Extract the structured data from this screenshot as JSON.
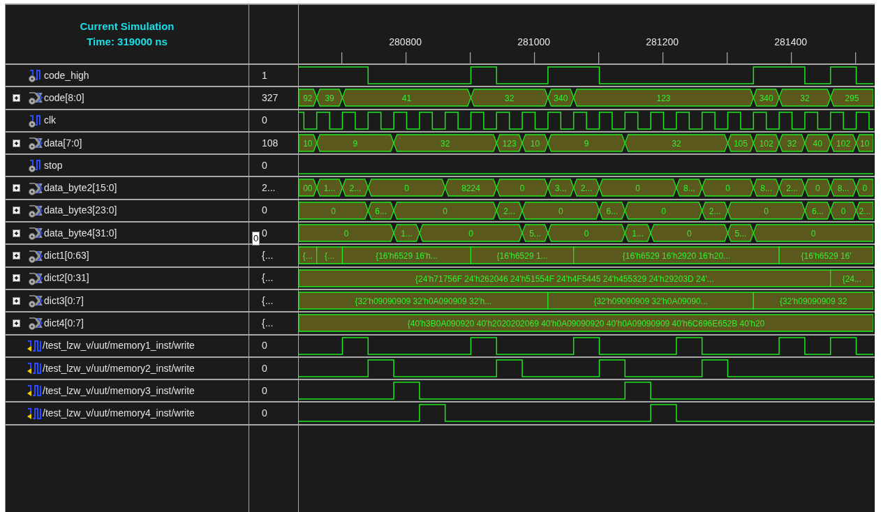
{
  "header": {
    "title": "Current Simulation",
    "time": "Time: 319000 ns"
  },
  "ruler": {
    "labels": [
      "280800",
      "281000",
      "281200",
      "281400"
    ]
  },
  "signals": [
    {
      "name": "code_high",
      "value": "1",
      "kind": "bit"
    },
    {
      "name": "code[8:0]",
      "value": "327",
      "kind": "bus",
      "expanded": false,
      "segments": [
        "92",
        "39",
        "41",
        "32",
        "340",
        "123",
        "340",
        "32",
        "295"
      ]
    },
    {
      "name": "clk",
      "value": "0",
      "kind": "bit"
    },
    {
      "name": "data[7:0]",
      "value": "108",
      "kind": "bus",
      "expanded": false,
      "segments": [
        "10",
        "9",
        "32",
        "123",
        "10",
        "9",
        "32",
        "105",
        "102",
        "32",
        "40",
        "102",
        "10"
      ]
    },
    {
      "name": "stop",
      "value": "0",
      "kind": "bit"
    },
    {
      "name": "data_byte2[15:0]",
      "value": "2...",
      "kind": "bus",
      "expanded": false,
      "segments": [
        "00",
        "1...",
        "2...",
        "0",
        "8224",
        "0",
        "3...",
        "2...",
        "0",
        "8...",
        "0",
        "8...",
        "2...",
        "0",
        "8...",
        "0"
      ]
    },
    {
      "name": "data_byte3[23:0]",
      "value": "0",
      "kind": "bus",
      "expanded": false,
      "segments": [
        "0",
        "6...",
        "0",
        "2...",
        "0",
        "6...",
        "0",
        "2...",
        "0",
        "6...",
        "0",
        "2..."
      ]
    },
    {
      "name": "data_byte4[31:0]",
      "value": "0",
      "tooltip": "0",
      "kind": "bus",
      "expanded": false,
      "segments": [
        "0",
        "1...",
        "0",
        "5...",
        "0",
        "1...",
        "0",
        "5...",
        "0"
      ]
    },
    {
      "name": "dict1[0:63]",
      "value": "{...",
      "kind": "bus",
      "expanded": false,
      "segments": [
        "{...",
        "{...",
        "{16'h6529 16'h...",
        "{16'h6529 1...",
        "{16'h6529 16'h2920 16'h20...",
        "{16'h6529 16'"
      ]
    },
    {
      "name": "dict2[0:31]",
      "value": "{...",
      "kind": "bus",
      "expanded": false,
      "segments": [
        "{24'h71756F 24'h262046 24'h51554F 24'h4F5445 24'h455329 24'h29203D 24'...",
        "{24..."
      ]
    },
    {
      "name": "dict3[0:7]",
      "value": "{...",
      "kind": "bus",
      "expanded": false,
      "segments": [
        "{32'h09090909 32'h0A090909 32'h...",
        "{32'h09090909 32'h0A09090...",
        "{32'h09090909 32"
      ]
    },
    {
      "name": "dict4[0:7]",
      "value": "{...",
      "kind": "bus",
      "expanded": false,
      "segments": [
        "{40'h3B0A090920 40'h2020202069 40'h0A09090920 40'h0A09090909 40'h6C696E652B 40'h20"
      ]
    },
    {
      "name": "/test_lzw_v/uut/memory1_inst/write",
      "value": "0",
      "kind": "port"
    },
    {
      "name": "/test_lzw_v/uut/memory2_inst/write",
      "value": "0",
      "kind": "port"
    },
    {
      "name": "/test_lzw_v/uut/memory3_inst/write",
      "value": "0",
      "kind": "port"
    },
    {
      "name": "/test_lzw_v/uut/memory4_inst/write",
      "value": "0",
      "kind": "port"
    }
  ]
}
